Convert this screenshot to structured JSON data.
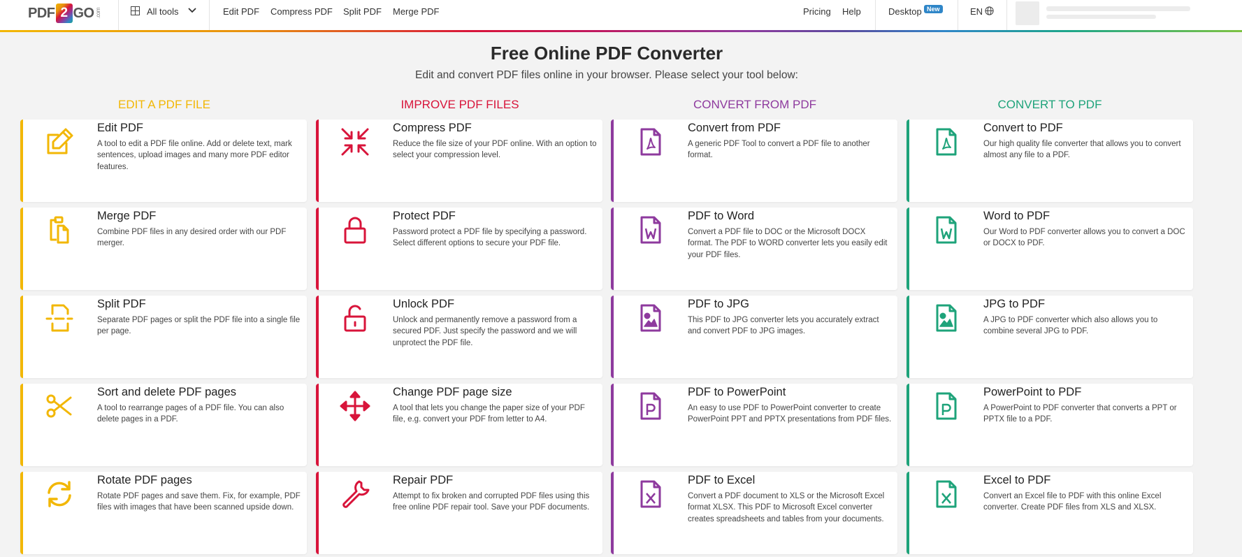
{
  "header": {
    "logo": {
      "pdf": "PDF",
      "two": "2",
      "go": "GO",
      "com": ".com"
    },
    "all_tools": "All tools",
    "nav": [
      "Edit PDF",
      "Compress PDF",
      "Split PDF",
      "Merge PDF"
    ],
    "pricing": "Pricing",
    "help": "Help",
    "desktop": "Desktop",
    "desktop_badge": "New",
    "language": "EN"
  },
  "main": {
    "title": "Free Online PDF Converter",
    "subtitle": "Edit and convert PDF files online in your browser. Please select your tool below:"
  },
  "colors": {
    "edit": "#f2b705",
    "improve": "#d8143a",
    "convert_from": "#8e3a9e",
    "convert_to": "#1ea37a"
  },
  "columns": [
    {
      "heading": "Edit a PDF file",
      "color": "#f2b705",
      "tools": [
        {
          "title": "Edit PDF",
          "icon": "edit-icon",
          "desc": "A tool to edit a PDF file online. Add or delete text, mark sentences, upload images and many more PDF editor features."
        },
        {
          "title": "Merge PDF",
          "icon": "merge-icon",
          "desc": "Combine PDF files in any desired order with our PDF merger."
        },
        {
          "title": "Split PDF",
          "icon": "split-icon",
          "desc": "Separate PDF pages or split the PDF file into a single file per page."
        },
        {
          "title": "Sort and delete PDF pages",
          "icon": "scissors-icon",
          "desc": "A tool to rearrange pages of a PDF file. You can also delete pages in a PDF."
        },
        {
          "title": "Rotate PDF pages",
          "icon": "rotate-icon",
          "desc": "Rotate PDF pages and save them. Fix, for example, PDF files with images that have been scanned upside down."
        }
      ]
    },
    {
      "heading": "Improve PDF files",
      "color": "#d8143a",
      "tools": [
        {
          "title": "Compress PDF",
          "icon": "compress-icon",
          "desc": "Reduce the file size of your PDF online. With an option to select your compression level."
        },
        {
          "title": "Protect PDF",
          "icon": "lock-icon",
          "desc": "Password protect a PDF file by specifying a password. Select different options to secure your PDF file."
        },
        {
          "title": "Unlock PDF",
          "icon": "unlock-icon",
          "desc": "Unlock and permanently remove a password from a secured PDF. Just specify the password and we will unprotect the PDF file."
        },
        {
          "title": "Change PDF page size",
          "icon": "move-arrows-icon",
          "desc": "A tool that lets you change the paper size of your PDF file, e.g. convert your PDF from letter to A4."
        },
        {
          "title": "Repair PDF",
          "icon": "wrench-icon",
          "desc": "Attempt to fix broken and corrupted PDF files using this free online PDF repair tool. Save your PDF documents."
        }
      ]
    },
    {
      "heading": "Convert from PDF",
      "color": "#8e3a9e",
      "tools": [
        {
          "title": "Convert from PDF",
          "icon": "file-pdf-icon",
          "desc": "A generic PDF Tool to convert a PDF file to another format."
        },
        {
          "title": "PDF to Word",
          "icon": "file-word-icon",
          "desc": "Convert a PDF file to DOC or the Microsoft DOCX format. The PDF to WORD converter lets you easily edit your PDF files."
        },
        {
          "title": "PDF to JPG",
          "icon": "file-image-icon",
          "desc": "This PDF to JPG converter lets you accurately extract and convert PDF to JPG images."
        },
        {
          "title": "PDF to PowerPoint",
          "icon": "file-powerpoint-icon",
          "desc": "An easy to use PDF to PowerPoint converter to create PowerPoint PPT and PPTX presentations from PDF files."
        },
        {
          "title": "PDF to Excel",
          "icon": "file-excel-icon",
          "desc": "Convert a PDF document to XLS or the Microsoft Excel format XLSX. This PDF to Microsoft Excel converter creates spreadsheets and tables from your documents."
        }
      ]
    },
    {
      "heading": "Convert to PDF",
      "color": "#1ea37a",
      "tools": [
        {
          "title": "Convert to PDF",
          "icon": "file-pdf-icon",
          "desc": "Our high quality file converter that allows you to convert almost any file to a PDF."
        },
        {
          "title": "Word to PDF",
          "icon": "file-word-icon",
          "desc": "Our Word to PDF converter allows you to convert a DOC or DOCX to PDF."
        },
        {
          "title": "JPG to PDF",
          "icon": "file-image-icon",
          "desc": "A JPG to PDF converter which also allows you to combine several JPG to PDF."
        },
        {
          "title": "PowerPoint to PDF",
          "icon": "file-powerpoint-icon",
          "desc": "A PowerPoint to PDF converter that converts a PPT or PPTX file to a PDF."
        },
        {
          "title": "Excel to PDF",
          "icon": "file-excel-icon",
          "desc": "Convert an Excel file to PDF with this online Excel converter. Create PDF files from XLS and XLSX."
        }
      ]
    }
  ]
}
